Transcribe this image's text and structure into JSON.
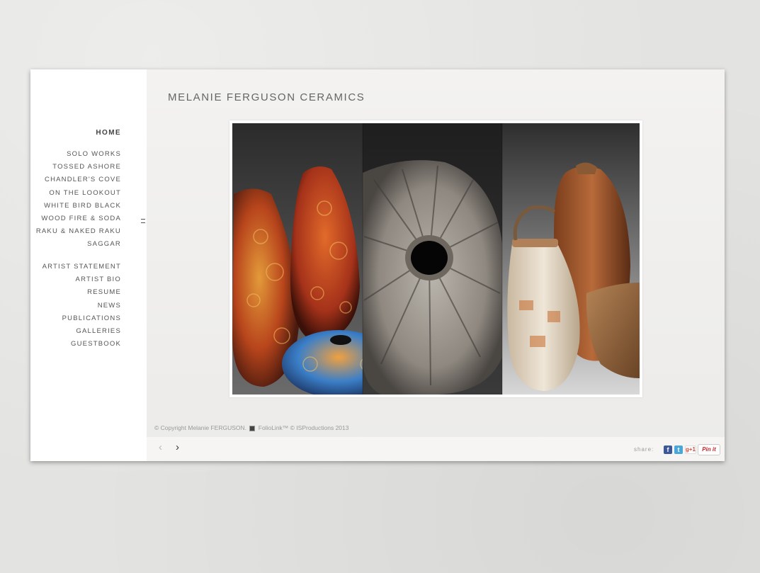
{
  "site": {
    "title": "MELANIE FERGUSON CERAMICS"
  },
  "nav": {
    "home": "HOME",
    "portfolio": [
      "SOLO WORKS",
      "TOSSED ASHORE",
      "CHANDLER'S COVE",
      "ON THE LOOKOUT",
      "WHITE BIRD BLACK",
      "WOOD FIRE & SODA",
      "RAKU & NAKED RAKU",
      "SAGGAR"
    ],
    "info": [
      "ARTIST STATEMENT",
      "ARTIST BIO",
      "RESUME",
      "NEWS",
      "PUBLICATIONS",
      "GALLERIES",
      "GUESTBOOK"
    ]
  },
  "footer": {
    "copyright_a": "© Copyright Melanie FERGUSON.",
    "copyright_b": "FolioLink™ © ISProductions 2013",
    "share_label": "share:",
    "prev_icon": "‹",
    "next_icon": "›",
    "google": "g+1",
    "pinit": "Pin it"
  },
  "icons": [
    "chevron-left-icon",
    "chevron-right-icon",
    "facebook-icon",
    "twitter-icon",
    "google-plus-icon",
    "pinterest-icon",
    "drag-handle-icon"
  ],
  "colors": {
    "sidebar": "#ffffff",
    "main": "#efeeec",
    "text": "#555555",
    "accent_pin": "#c8232c",
    "facebook": "#3b5998",
    "twitter": "#4aa8d8"
  }
}
